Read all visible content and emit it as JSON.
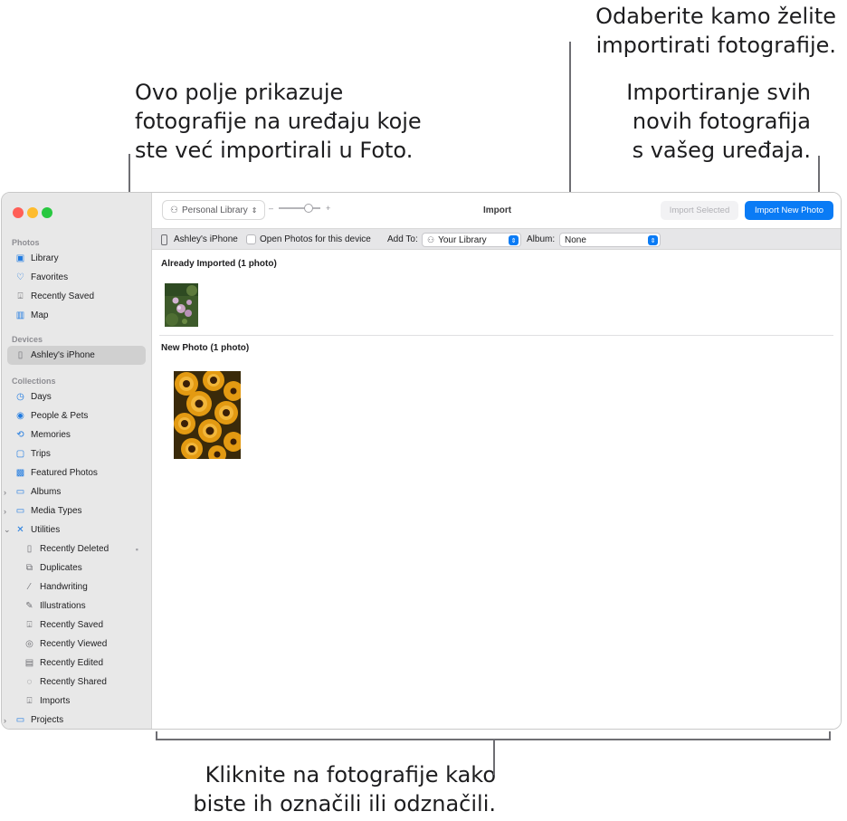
{
  "callouts": {
    "left": [
      "Ovo polje prikazuje",
      "fotografije na uređaju koje",
      "ste već importirali u Foto."
    ],
    "destination": [
      "Odaberite kamo želite",
      "importirati fotografije."
    ],
    "import_all": [
      "Importiranje svih",
      "novih fotografija",
      "s vašeg uređaja."
    ],
    "bottom": [
      "Kliknite na fotografije kako",
      "biste ih označili ili odznačili."
    ]
  },
  "sidebar": {
    "photos_header": "Photos",
    "photos_items": [
      {
        "label": "Library",
        "icon": "library-icon"
      },
      {
        "label": "Favorites",
        "icon": "heart-icon"
      },
      {
        "label": "Recently Saved",
        "icon": "tray-icon"
      },
      {
        "label": "Map",
        "icon": "map-icon"
      }
    ],
    "devices_header": "Devices",
    "device_item": "Ashley's iPhone",
    "collections_header": "Collections",
    "collections_items": [
      {
        "label": "Days",
        "icon": "clock-icon"
      },
      {
        "label": "People & Pets",
        "icon": "person-circle-icon"
      },
      {
        "label": "Memories",
        "icon": "memories-icon"
      },
      {
        "label": "Trips",
        "icon": "suitcase-icon"
      },
      {
        "label": "Featured Photos",
        "icon": "photo-icon"
      },
      {
        "label": "Albums",
        "icon": "folder-icon"
      },
      {
        "label": "Media Types",
        "icon": "folder-icon"
      },
      {
        "label": "Utilities",
        "icon": "tools-icon"
      }
    ],
    "utilities_items": [
      {
        "label": "Recently Deleted",
        "icon": "trash-icon"
      },
      {
        "label": "Duplicates",
        "icon": "duplicates-icon"
      },
      {
        "label": "Handwriting",
        "icon": "pen-icon"
      },
      {
        "label": "Illustrations",
        "icon": "brush-icon"
      },
      {
        "label": "Recently Saved",
        "icon": "tray-icon"
      },
      {
        "label": "Recently Viewed",
        "icon": "eye-icon"
      },
      {
        "label": "Recently Edited",
        "icon": "edit-icon"
      },
      {
        "label": "Recently Shared",
        "icon": "share-icon"
      },
      {
        "label": "Imports",
        "icon": "tray-icon"
      }
    ],
    "projects_item": "Projects"
  },
  "toolbar": {
    "library_label": "Personal Library",
    "zoom_minus": "–",
    "zoom_plus": "+",
    "title": "Import",
    "import_selected": "Import Selected",
    "import_new": "Import New Photo"
  },
  "device_bar": {
    "device_name": "Ashley's iPhone",
    "open_photos_label": "Open Photos for this device",
    "open_photos_checked": false,
    "add_to_label": "Add To:",
    "add_to_value": "Your Library",
    "album_label": "Album:",
    "album_value": "None"
  },
  "content": {
    "already_imported_title": "Already Imported (1 photo)",
    "new_photo_title": "New Photo (1 photo)"
  },
  "colors": {
    "accent": "#0a7bf5",
    "sidebar_bg": "#e8e8e8",
    "close": "#ff5f57",
    "minimize": "#febc2e",
    "maximize": "#28c840"
  }
}
